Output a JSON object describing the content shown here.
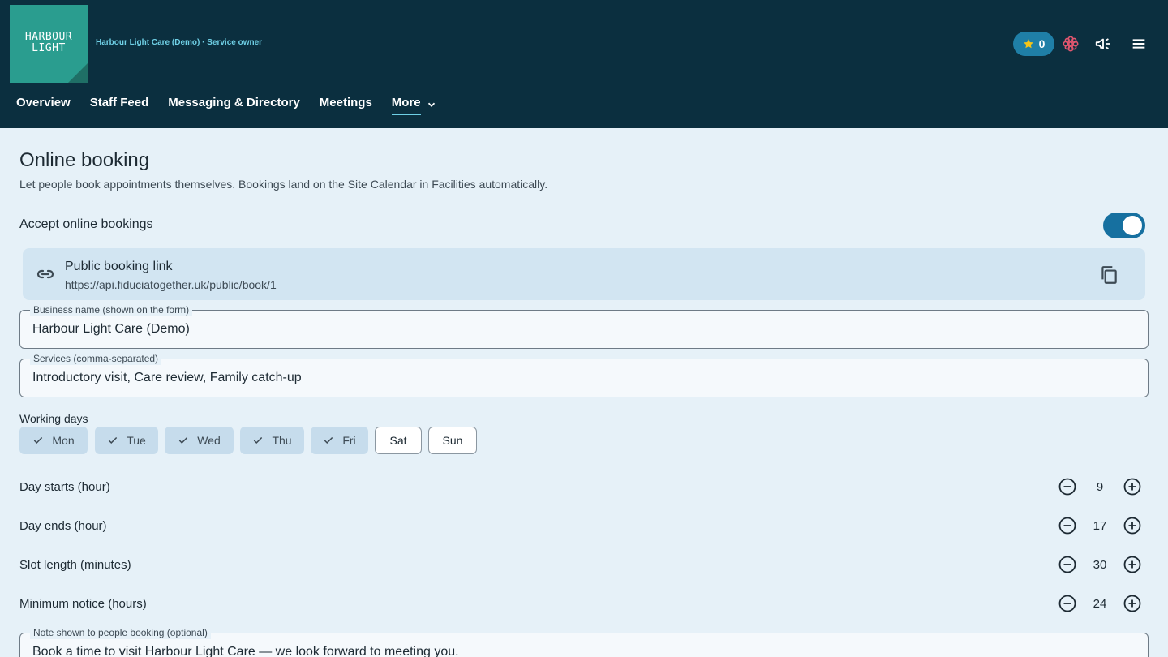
{
  "header": {
    "logo_line1": "HARBOUR",
    "logo_line2": "LIGHT",
    "org_role": "Harbour Light Care (Demo) · Service owner",
    "points": "0",
    "colors": {
      "bar": "#0b2f3f",
      "logo": "#2a9d8f",
      "badge": "#1f7fa7",
      "star": "#f5c518",
      "flower": "#e0566f"
    },
    "icons": [
      "star-icon",
      "flower-icon",
      "announcement-icon",
      "menu-icon"
    ]
  },
  "nav": {
    "items": [
      "Overview",
      "Staff Feed",
      "Messaging & Directory",
      "Meetings"
    ],
    "more_label": "More"
  },
  "page": {
    "title": "Online booking",
    "subtitle": "Let people book appointments themselves. Bookings land on the Site Calendar in Facilities automatically."
  },
  "accept": {
    "label": "Accept online bookings",
    "enabled": true
  },
  "link_card": {
    "title": "Public booking link",
    "url": "https://api.fiduciatogether.uk/public/book/1"
  },
  "fields": {
    "business_name": {
      "label": "Business name (shown on the form)",
      "value": "Harbour Light Care (Demo)"
    },
    "services": {
      "label": "Services (comma-separated)",
      "value": "Introductory visit, Care review, Family catch-up"
    },
    "note": {
      "label": "Note shown to people booking (optional)",
      "value": "Book a time to visit Harbour Light Care — we look forward to meeting you."
    }
  },
  "working_days": {
    "label": "Working days",
    "days": [
      {
        "name": "Mon",
        "selected": true
      },
      {
        "name": "Tue",
        "selected": true
      },
      {
        "name": "Wed",
        "selected": true
      },
      {
        "name": "Thu",
        "selected": true
      },
      {
        "name": "Fri",
        "selected": true
      },
      {
        "name": "Sat",
        "selected": false
      },
      {
        "name": "Sun",
        "selected": false
      }
    ]
  },
  "steppers": [
    {
      "label": "Day starts (hour)",
      "value": "9"
    },
    {
      "label": "Day ends (hour)",
      "value": "17"
    },
    {
      "label": "Slot length (minutes)",
      "value": "30"
    },
    {
      "label": "Minimum notice (hours)",
      "value": "24"
    }
  ]
}
